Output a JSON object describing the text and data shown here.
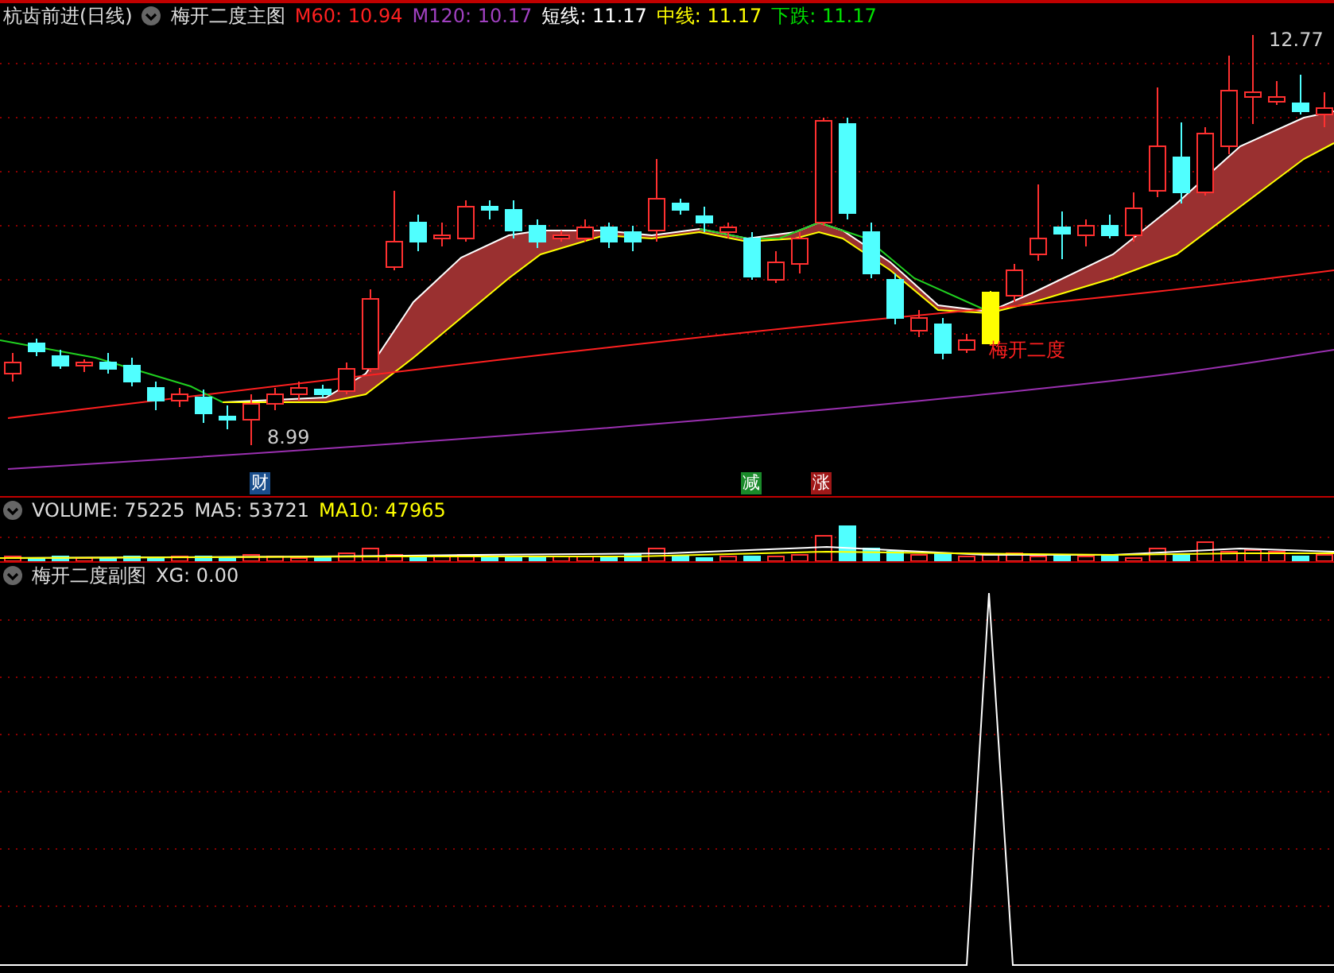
{
  "main_panel": {
    "title": "杭齿前进(日线)",
    "indicator": "梅开二度主图",
    "values": [
      {
        "text": "M60: 10.94",
        "color": "#ff2020"
      },
      {
        "text": "M120: 10.17",
        "color": "#a040c0"
      },
      {
        "text": "短线: 11.17",
        "color": "#ffffff"
      },
      {
        "text": "中线: 11.17",
        "color": "#ffff00"
      },
      {
        "text": "下跌: 11.17",
        "color": "#00e000"
      }
    ],
    "high_label": "12.77",
    "low_label": "8.99",
    "signal_label": "梅开二度",
    "markers": [
      {
        "text": "财",
        "color": "#1a4e8c"
      },
      {
        "text": "减",
        "color": "#1a8a2a"
      },
      {
        "text": "涨",
        "color": "#a01818"
      }
    ]
  },
  "volume_panel": {
    "values": [
      {
        "text": "VOLUME: 75225",
        "color": "#dddddd"
      },
      {
        "text": "MA5: 53721",
        "color": "#dddddd"
      },
      {
        "text": "MA10: 47965",
        "color": "#ffff00"
      }
    ]
  },
  "sub_panel": {
    "title": "梅开二度副图",
    "values": [
      {
        "text": "XG: 0.00",
        "color": "#dddddd"
      }
    ]
  }
}
